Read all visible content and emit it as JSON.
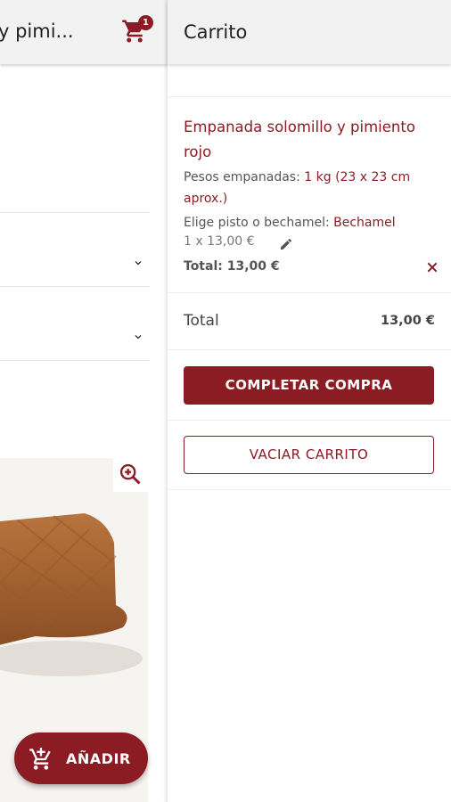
{
  "product_page": {
    "title": "y pimi...",
    "cart_badge_count": "1",
    "add_button_label": "AÑADIR"
  },
  "cart": {
    "title": "Carrito",
    "item": {
      "name": "Empanada solomillo y pimiento rojo",
      "attributes": [
        {
          "label": "Pesos empanadas: ",
          "value": "1 kg (23 x 23 cm aprox.)"
        },
        {
          "label": "Elige pisto o bechamel: ",
          "value": "Bechamel"
        }
      ],
      "quantity_price": "1 x 13,00 €",
      "total": "Total: 13,00 €"
    },
    "total_label": "Total",
    "total_value": "13,00 €",
    "complete_button": "COMPLETAR COMPRA",
    "empty_button": "VACIAR CARRITO"
  },
  "colors": {
    "accent": "#8b1c24",
    "header_bg": "#f2f2f2"
  }
}
